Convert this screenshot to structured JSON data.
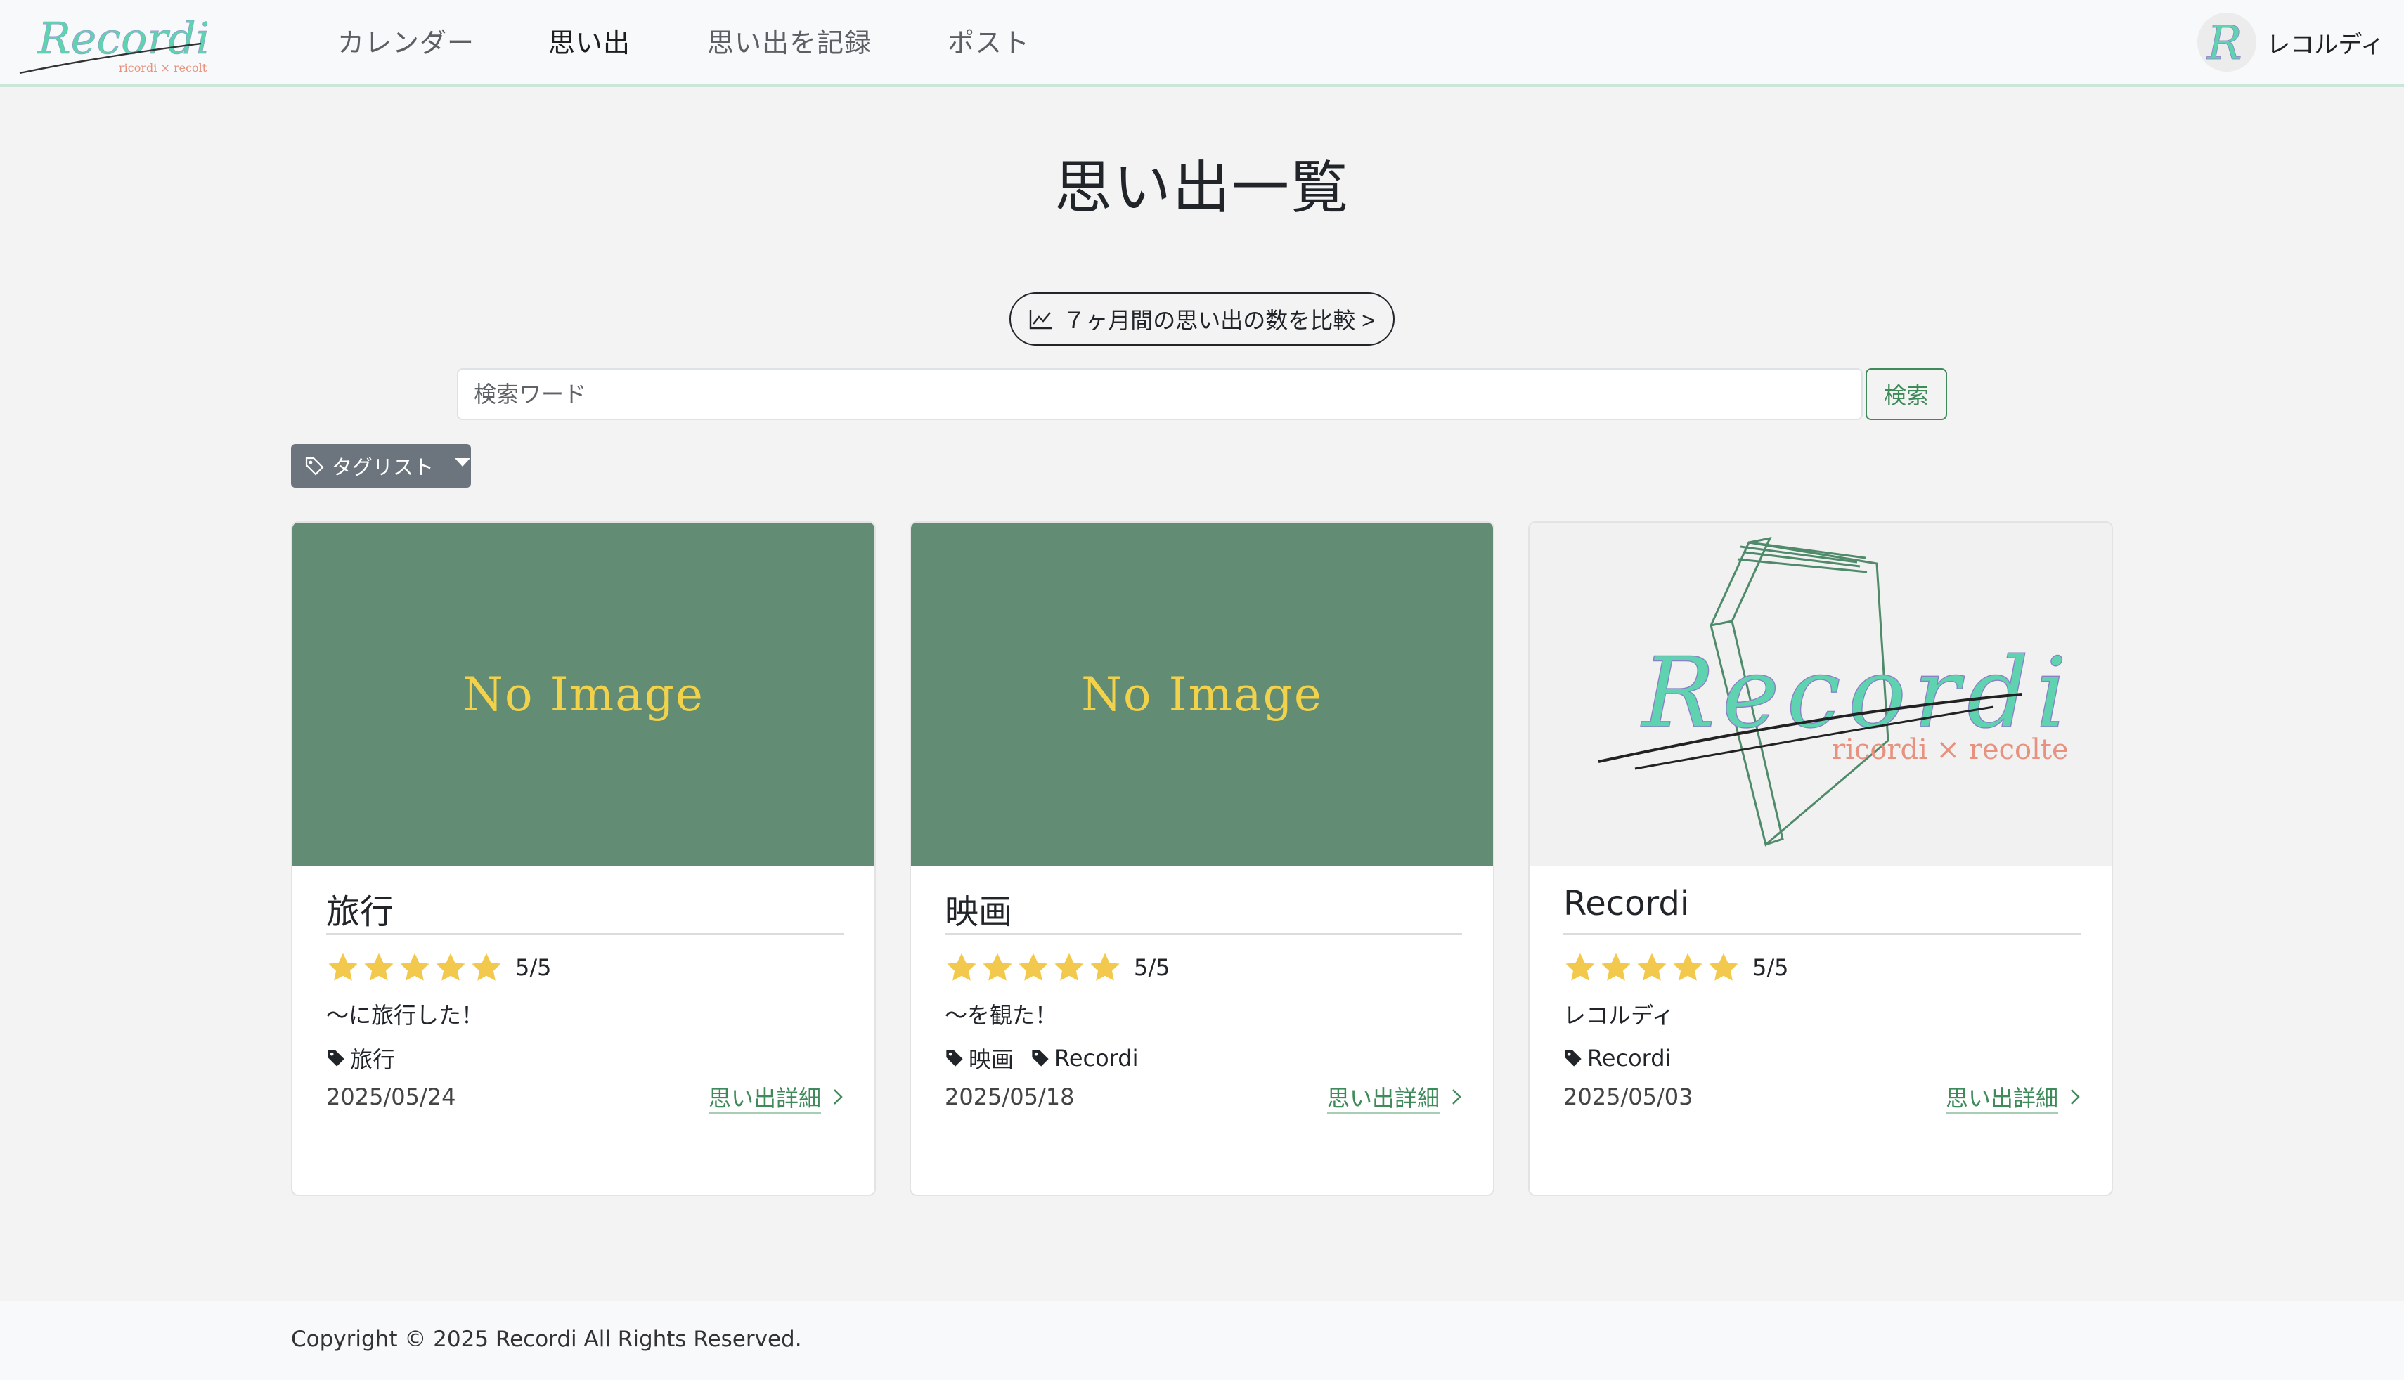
{
  "header": {
    "brand": {
      "name": "Recordi",
      "tagline": "ricordi × recolte"
    },
    "nav": [
      {
        "label": "カレンダー"
      },
      {
        "label": "思い出"
      },
      {
        "label": "思い出を記録"
      },
      {
        "label": "ポスト"
      }
    ],
    "active_nav": "思い出",
    "user": {
      "avatar_letter": "R",
      "name": "レコルディ"
    }
  },
  "main": {
    "title": "思い出一覧",
    "compare_button": "７ヶ月間の思い出の数を比較 >",
    "search": {
      "placeholder": "検索ワード",
      "button": "検索"
    },
    "tag_dropdown": "タグリスト"
  },
  "cards": [
    {
      "image_text": "No Image",
      "title": "旅行",
      "rating_stars": 5,
      "rating": "5/5",
      "description": "〜に旅行した！",
      "tags": [
        "旅行"
      ],
      "date": "2025/05/24",
      "link": "思い出詳細"
    },
    {
      "image_text": "No Image",
      "title": "映画",
      "rating_stars": 5,
      "rating": "5/5",
      "description": "〜を観た！",
      "tags": [
        "映画",
        "Recordi"
      ],
      "date": "2025/05/18",
      "link": "思い出詳細"
    },
    {
      "image_logo": {
        "name": "Recordi",
        "tagline": "ricordi × recolte"
      },
      "title": "Recordi",
      "rating_stars": 5,
      "rating": "5/5",
      "description": "レコルディ",
      "tags": [
        "Recordi"
      ],
      "date": "2025/05/03",
      "link": "思い出詳細"
    }
  ],
  "footer": {
    "copyright": "Copyright © 2025 Recordi All Rights Reserved."
  },
  "colors": {
    "accent_green": "#3f8a5a",
    "noimage_bg": "#628c73",
    "noimage_text": "#f2d24a",
    "star": "#f2c94c",
    "logo_teal": "#5fd3b0",
    "logo_coral": "#e8917e"
  }
}
